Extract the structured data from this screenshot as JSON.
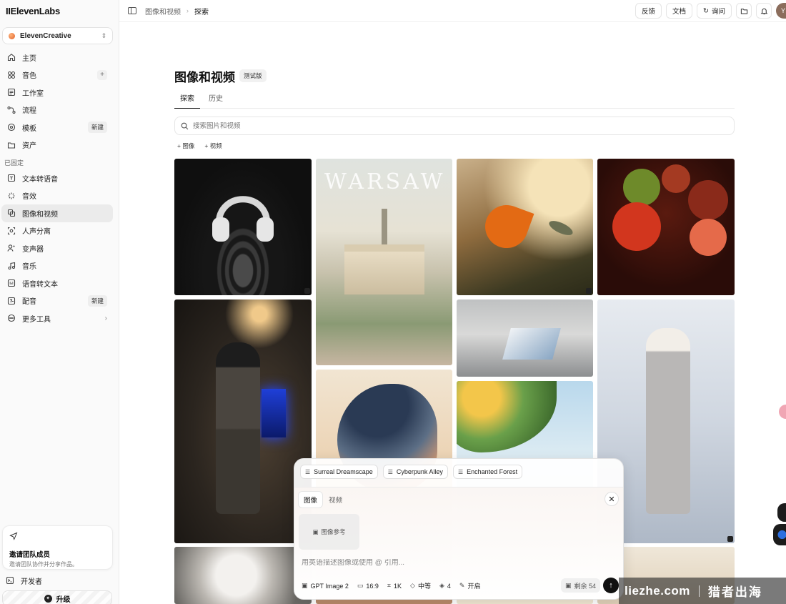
{
  "sidebar": {
    "logo": "IIElevenLabs",
    "workspace": "ElevenCreative",
    "nav": [
      {
        "label": "主页",
        "icon": "home-icon"
      },
      {
        "label": "音色",
        "icon": "voices-grid-icon",
        "plus": "+"
      },
      {
        "label": "工作室",
        "icon": "studio-icon"
      },
      {
        "label": "流程",
        "icon": "flow-icon"
      },
      {
        "label": "模板",
        "icon": "template-icon",
        "badge": "新建"
      },
      {
        "label": "资产",
        "icon": "folder-icon"
      }
    ],
    "pinned_label": "已固定",
    "pinned": [
      {
        "label": "文本转语音",
        "icon": "text-to-speech-icon"
      },
      {
        "label": "音效",
        "icon": "sound-effects-icon"
      },
      {
        "label": "图像和视频",
        "icon": "image-video-icon",
        "active": true
      },
      {
        "label": "人声分离",
        "icon": "voice-isolator-icon"
      },
      {
        "label": "变声器",
        "icon": "voice-changer-icon"
      },
      {
        "label": "音乐",
        "icon": "music-icon"
      },
      {
        "label": "语音转文本",
        "icon": "speech-to-text-icon"
      },
      {
        "label": "配音",
        "icon": "dubbing-icon",
        "badge": "新建"
      },
      {
        "label": "更多工具",
        "icon": "more-tools-icon",
        "arrow": "›"
      }
    ],
    "invite": {
      "title": "邀请团队成员",
      "subtitle": "邀请团队协作并分享作品。"
    },
    "developer": "开发者",
    "upgrade": "升级"
  },
  "topbar": {
    "breadcrumb": [
      "图像和视频",
      "探索"
    ],
    "feedback": "反馈",
    "docs": "文档",
    "inquiry": "询问",
    "avatar_initial": "Y"
  },
  "main": {
    "title": "图像和视频",
    "beta": "测试版",
    "tabs": [
      "探索",
      "历史"
    ],
    "search_placeholder": "搜索图片和视频",
    "filters": [
      "+ 图像",
      "+ 视频"
    ]
  },
  "composer": {
    "presets": [
      "Surreal Dreamscape",
      "Cyberpunk Alley",
      "Enchanted Forest"
    ],
    "mode_tabs": [
      "图像",
      "视频"
    ],
    "image_ref": "图像参考",
    "prompt_placeholder": "用英语描述图像或使用 @ 引用...",
    "model": "GPT Image 2",
    "aspect": "16:9",
    "resolution": "1K",
    "quality": "中等",
    "count": "4",
    "toggle": "开启",
    "credits": "剩余 54"
  },
  "watermark": {
    "en": "liezhe.com",
    "cn": "猎者出海"
  },
  "colors": {
    "accent": "#111111",
    "sidebar_bg": "#fafafa",
    "active_item": "#ebebeb"
  }
}
